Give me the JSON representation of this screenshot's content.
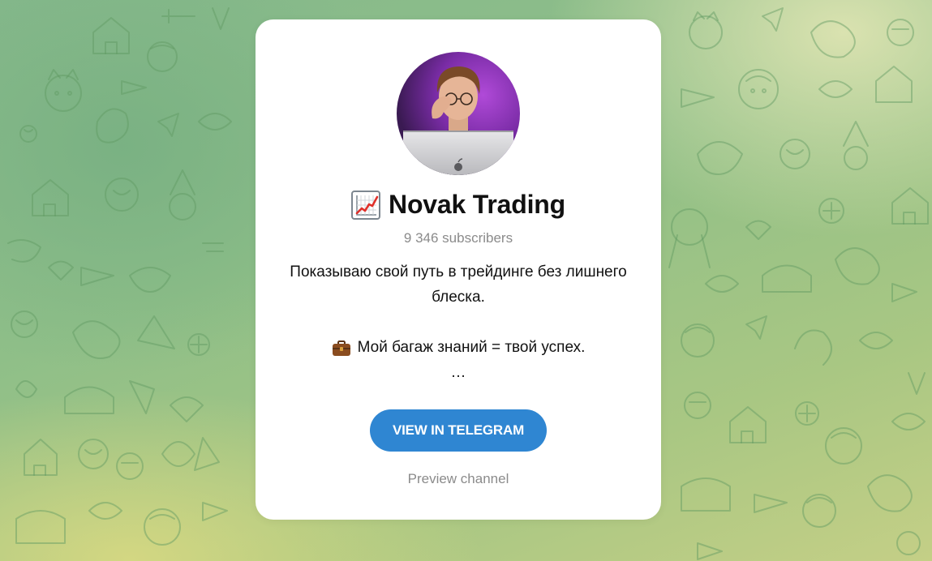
{
  "channel": {
    "title_icon": "chart-increasing-emoji",
    "title": "Novak Trading",
    "subscribers": "9 346 subscribers",
    "description": {
      "line1": "Показываю свой путь в трейдинге без лишнего блеска.",
      "line2_icon": "briefcase-emoji",
      "line2": "Мой багаж знаний = твой успех.",
      "ellipsis": "…"
    },
    "avatar": "channel-avatar-photo"
  },
  "actions": {
    "view_button_label": "VIEW IN TELEGRAM",
    "preview_link_label": "Preview channel"
  },
  "colors": {
    "button": "#2f86d2",
    "card": "#ffffff",
    "muted_text": "#8b8b8b",
    "background_green": "#86b98c",
    "background_yellow": "#c4cf86"
  }
}
